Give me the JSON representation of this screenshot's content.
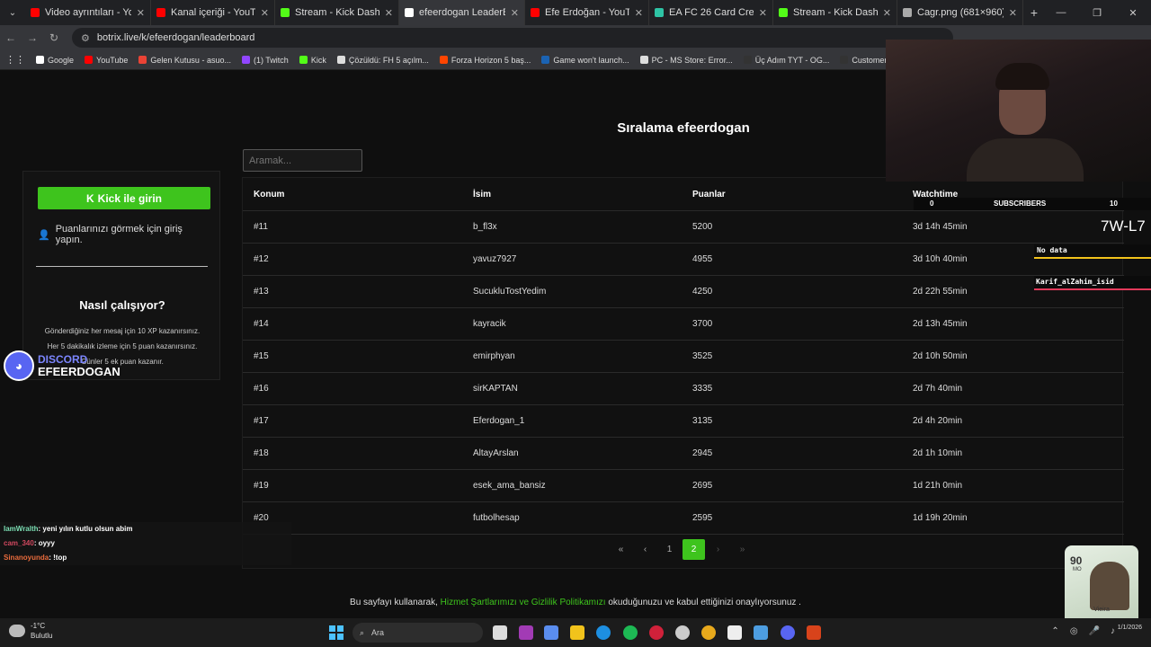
{
  "browser": {
    "tabs": [
      {
        "label": "Video ayrıntıları - YouTube",
        "color": "#ff0000",
        "active": false
      },
      {
        "label": "Kanal içeriği - YouTube St",
        "color": "#ff0000",
        "active": false
      },
      {
        "label": "Stream - Kick Dashboard",
        "color": "#53fc18",
        "active": false
      },
      {
        "label": "efeerdogan LeaderBoard",
        "color": "#ffffff",
        "active": true
      },
      {
        "label": "Efe Erdoğan - YouTube",
        "color": "#ff0000",
        "active": false
      },
      {
        "label": "EA FC 26 Card Creator | G",
        "color": "#2ec4a5",
        "active": false
      },
      {
        "label": "Stream - Kick Dashboard",
        "color": "#53fc18",
        "active": false
      },
      {
        "label": "Cagr.png (681×960)",
        "color": "#aaaaaa",
        "active": false
      }
    ],
    "url": "botrix.live/k/efeerdogan/leaderboard",
    "bookmarks": [
      {
        "label": "Google",
        "color": "#ffffff"
      },
      {
        "label": "YouTube",
        "color": "#ff0000"
      },
      {
        "label": "Gelen Kutusu - asuo...",
        "color": "#ea4335"
      },
      {
        "label": "(1) Twitch",
        "color": "#9146ff"
      },
      {
        "label": "Kick",
        "color": "#53fc18"
      },
      {
        "label": "Çözüldü: FH 5 açılm...",
        "color": "#dddddd"
      },
      {
        "label": "Forza Horizon 5 baş...",
        "color": "#ff4500"
      },
      {
        "label": "Game won't launch...",
        "color": "#1b63b3"
      },
      {
        "label": "PC - MS Store: Error...",
        "color": "#dddddd"
      },
      {
        "label": "Üç Adım TYT - OG...",
        "color": "#333333"
      },
      {
        "label": "Customer support –...",
        "color": "#333333"
      },
      {
        "label": "Ki",
        "color": "#53fc18"
      }
    ]
  },
  "page": {
    "title": "Sıralama efeerdogan",
    "search_placeholder": "Aramak...",
    "login": {
      "button_label": "Kick ile girin",
      "note": "Puanlarınızı görmek için giriş yapın.",
      "how_title": "Nasıl çalışıyor?",
      "how_line1": "Gönderdiğiniz her mesaj için 10 XP kazanırsınız.",
      "how_line2": "Her 5 dakikalık izleme için 5 puan kazanırsınız.",
      "how_line3": "Günler 5 ek puan kazanır."
    },
    "table": {
      "headers": [
        "Konum",
        "İsim",
        "Puanlar",
        "Watchtime"
      ],
      "rows": [
        {
          "rank": "#11",
          "name": "b_fl3x",
          "points": "5200",
          "watchtime": "3d 14h 45min"
        },
        {
          "rank": "#12",
          "name": "yavuz7927",
          "points": "4955",
          "watchtime": "3d 10h 40min"
        },
        {
          "rank": "#13",
          "name": "SucukluTostYedim",
          "points": "4250",
          "watchtime": "2d 22h 55min"
        },
        {
          "rank": "#14",
          "name": "kayracik",
          "points": "3700",
          "watchtime": "2d 13h 45min"
        },
        {
          "rank": "#15",
          "name": "emirphyan",
          "points": "3525",
          "watchtime": "2d 10h 50min"
        },
        {
          "rank": "#16",
          "name": "sirKAPTAN",
          "points": "3335",
          "watchtime": "2d 7h 40min"
        },
        {
          "rank": "#17",
          "name": "Eferdogan_1",
          "points": "3135",
          "watchtime": "2d 4h 20min"
        },
        {
          "rank": "#18",
          "name": "AltayArslan",
          "points": "2945",
          "watchtime": "2d 1h 10min"
        },
        {
          "rank": "#19",
          "name": "esek_ama_bansiz",
          "points": "2695",
          "watchtime": "1d 21h 0min"
        },
        {
          "rank": "#20",
          "name": "futbolhesap",
          "points": "2595",
          "watchtime": "1d 19h 20min"
        }
      ]
    },
    "pagination": {
      "first": "«",
      "prev": "‹",
      "page1": "1",
      "page2": "2",
      "next": "›",
      "last": "»"
    },
    "footer": {
      "prefix": "Bu sayfayı kullanarak, ",
      "link": "Hizmet Şartlarımızı ve Gizlilik Politikamızı",
      "suffix": " okuduğunuzu ve kabul ettiğinizi onaylıyorsunuz ."
    }
  },
  "overlays": {
    "discord_label": "DISCORD",
    "discord_name": "EFEERDOGAN",
    "subs_left": "0",
    "subs_label": "SUBSCRIBERS",
    "subs_right": "10",
    "code": "7W-L7",
    "nodata": "No data",
    "karif": "Karif_alZahim_isid",
    "chat": [
      {
        "user": "IamWralth",
        "msg": ": yeni yılın kutlu olsun abim"
      },
      {
        "user": "cam_340",
        "msg": ": oyyy"
      },
      {
        "user": "Sinanoyunda",
        "msg": ": !top"
      }
    ],
    "card": {
      "rating": "90",
      "position": "MO",
      "name": "Vieira"
    }
  },
  "taskbar": {
    "temp": "-1°C",
    "weather": "Bulutlu",
    "search": "Ara",
    "date": "1/1/2026"
  }
}
